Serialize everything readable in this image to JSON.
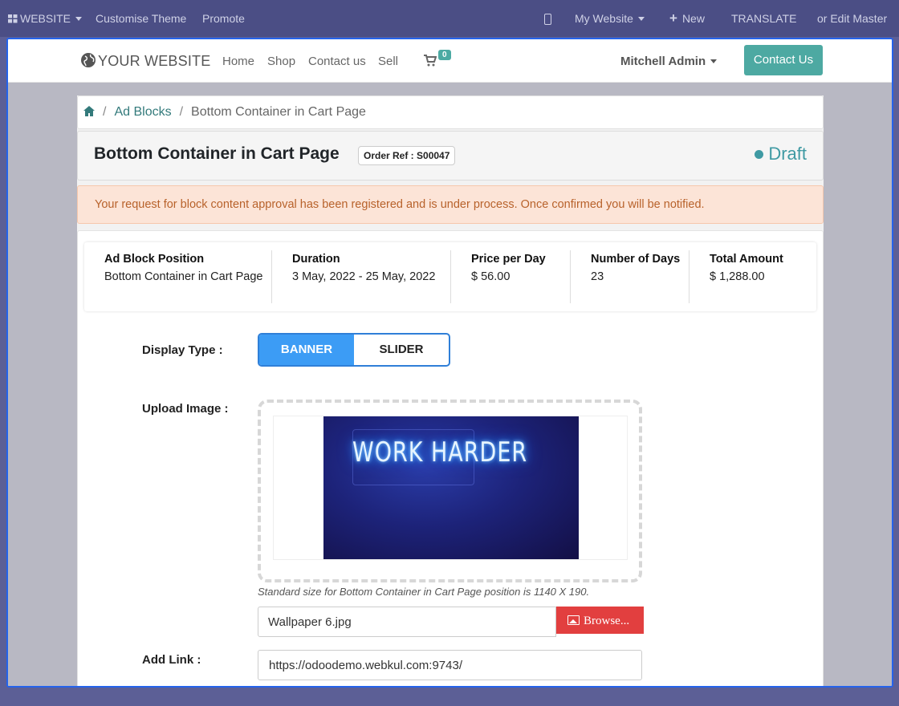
{
  "admin_bar": {
    "website_menu": "WEBSITE",
    "customise_theme": "Customise Theme",
    "promote": "Promote",
    "my_website": "My Website",
    "new": "New",
    "translate": "TRANSLATE",
    "edit_master": "or Edit Master"
  },
  "site": {
    "logo_text": "YOUR WEBSITE",
    "nav": [
      "Home",
      "Shop",
      "Contact us",
      "Sell"
    ],
    "cart_count": "0",
    "user_name": "Mitchell Admin",
    "contact_button": "Contact Us"
  },
  "breadcrumb": {
    "parent": "Ad Blocks",
    "current": "Bottom Container in Cart Page"
  },
  "page": {
    "title": "Bottom Container in Cart Page",
    "order_ref": "Order Ref : S00047",
    "status": "Draft",
    "alert": "Your request for block content approval has been registered and is under process. Once confirmed you will be notified."
  },
  "details": [
    {
      "label": "Ad Block Position",
      "value": "Bottom Container in Cart Page"
    },
    {
      "label": "Duration",
      "value": "3 May, 2022 - 25 May, 2022"
    },
    {
      "label": "Price per Day",
      "value": "$ 56.00"
    },
    {
      "label": "Number of Days",
      "value": "23"
    },
    {
      "label": "Total Amount",
      "value": "$ 1,288.00"
    }
  ],
  "form": {
    "display_type_label": "Display Type :",
    "display_options": [
      "BANNER",
      "SLIDER"
    ],
    "selected_display": "BANNER",
    "upload_label": "Upload Image :",
    "image_text": "WORK HARDER",
    "hint": "Standard size for Bottom Container in Cart Page position is 1140 X 190.",
    "file_name": "Wallpaper 6.jpg",
    "browse": "Browse...",
    "link_label": "Add Link :",
    "link_value": "https://odoodemo.webkul.com:9743/"
  },
  "colors": {
    "accent": "#4da9a2",
    "toggle_active": "#3c9cf5",
    "browse_button": "#e23f3f",
    "status": "#3f9aa3",
    "frame_border": "#2563eb"
  }
}
